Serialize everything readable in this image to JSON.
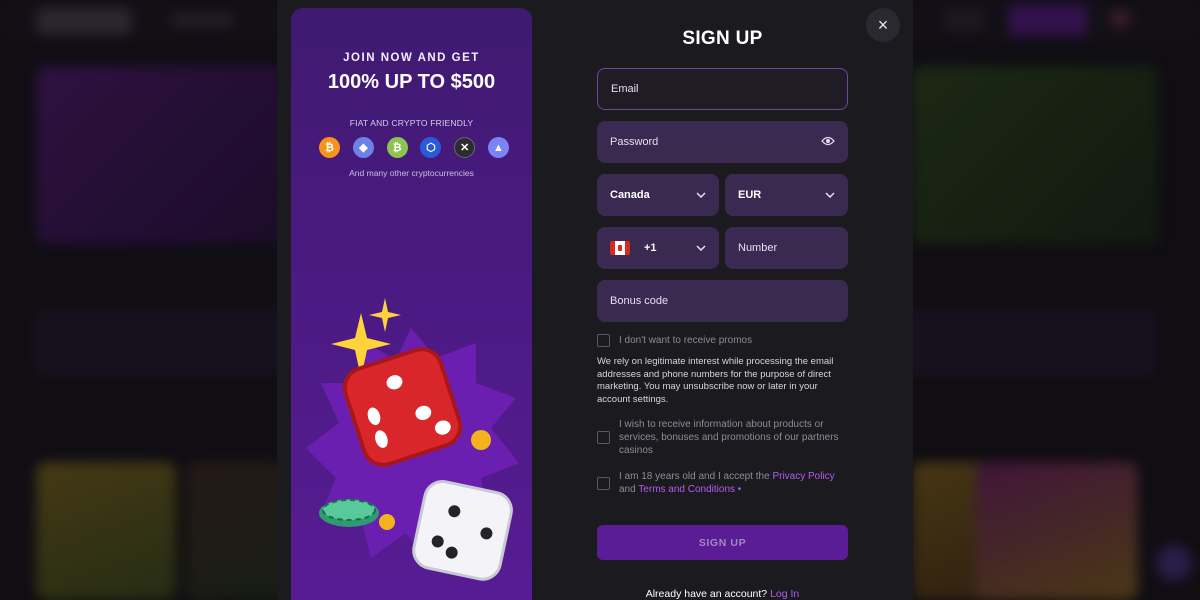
{
  "modal": {
    "close_icon": "×",
    "title": "SIGN UP"
  },
  "promo": {
    "kicker": "JOIN NOW AND GET",
    "headline": "100% UP TO $500",
    "fiat_line": "FIAT AND CRYPTO FRIENDLY",
    "coins": [
      {
        "name": "bitcoin-icon",
        "glyph": "₿",
        "color": "#f7931a"
      },
      {
        "name": "ethereum-icon",
        "glyph": "◆",
        "color": "#6d82e6"
      },
      {
        "name": "bitcoin-cash-icon",
        "glyph": "₿",
        "color": "#8dc351"
      },
      {
        "name": "chainlink-icon",
        "glyph": "⬡",
        "color": "#2a5ada"
      },
      {
        "name": "xrp-icon",
        "glyph": "✕",
        "color": "#2c2c30"
      },
      {
        "name": "tron-icon",
        "glyph": "▲",
        "color": "#7a84f4"
      }
    ],
    "other_line": "And many other cryptocurrencies",
    "artwork_icon": "dice-icon"
  },
  "form": {
    "email_placeholder": "Email",
    "password_placeholder": "Password",
    "password_icon": "eye-icon",
    "country_value": "Canada",
    "currency_value": "EUR",
    "phone_code": "+1",
    "phone_flag": "canada-flag-icon",
    "number_placeholder": "Number",
    "bonus_placeholder": "Bonus code",
    "chevron": "⌄",
    "promos_checkbox": "I don't want to receive promos",
    "legal_text": "We rely on legitimate interest while processing the email addresses and phone numbers for the purpose of direct marketing. You may unsubscribe now or later in your account settings.",
    "partners_checkbox": "I wish to receive information about products or services, bonuses and promotions of our partners casinos",
    "age_prefix": "I am 18 years old and I accept the ",
    "privacy_link": "Privacy Policy",
    "age_middle": " and",
    "terms_link": "Terms and Conditions",
    "required_mark": " •",
    "submit_label": "SIGN UP",
    "have_account": "Already have an account? ",
    "login_link": "Log In"
  },
  "colors": {
    "accent": "#b45cf0",
    "submit_bg": "#5b1d96",
    "field_bg": "#3a2a52",
    "promo_bg": "#4a1a80"
  }
}
